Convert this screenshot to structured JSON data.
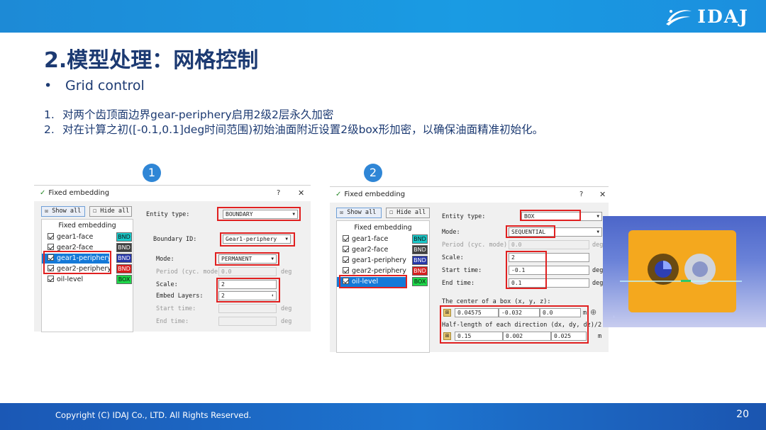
{
  "brand": {
    "logo_text": "IDAJ"
  },
  "slide": {
    "title": "2.模型处理：网格控制",
    "bullet": "Grid control",
    "items": [
      {
        "num": "1.",
        "text": "对两个齿顶面边界gear-periphery启用2级2层永久加密"
      },
      {
        "num": "2.",
        "text": "对在计算之初([-0.1,0.1]deg时间范围)初始油面附近设置2级box形加密，以确保油面精准初始化。"
      }
    ],
    "marker1": "1",
    "marker2": "2"
  },
  "dialog1": {
    "title": "Fixed embedding",
    "help": "?",
    "close": "✕",
    "show_all": "Show all",
    "hide_all": "Hide all",
    "tree_header": "Fixed embedding",
    "items": [
      {
        "label": "gear1-face",
        "tag": "BND",
        "tag_color": "#19c8c8"
      },
      {
        "label": "gear2-face",
        "tag": "BND",
        "tag_color": "#404040"
      },
      {
        "label": "gear1-periphery",
        "tag": "BND",
        "tag_color": "#2535a8"
      },
      {
        "label": "gear2-periphery",
        "tag": "BND",
        "tag_color": "#d81e1e"
      },
      {
        "label": "oil-level",
        "tag": "BOX",
        "tag_color": "#1ed84a"
      }
    ],
    "entity_type_label": "Entity type:",
    "entity_type_value": "BOUNDARY",
    "boundary_id_label": "Boundary ID:",
    "boundary_id_value": "Gear1-periphery",
    "mode_label": "Mode:",
    "mode_value": "PERMANENT",
    "period_label": "Period (cyc. mode):",
    "period_value": "0.0",
    "period_unit": "deg",
    "scale_label": "Scale:",
    "scale_value": "2",
    "embed_layers_label": "Embed Layers:",
    "embed_layers_value": "2",
    "start_time_label": "Start time:",
    "start_time_unit": "deg",
    "end_time_label": "End time:",
    "end_time_unit": "deg"
  },
  "dialog2": {
    "title": "Fixed embedding",
    "help": "?",
    "close": "✕",
    "show_all": "Show all",
    "hide_all": "Hide all",
    "tree_header": "Fixed embedding",
    "items": [
      {
        "label": "gear1-face",
        "tag": "BND",
        "tag_color": "#19c8c8"
      },
      {
        "label": "gear2-face",
        "tag": "BND",
        "tag_color": "#404040"
      },
      {
        "label": "gear1-periphery",
        "tag": "BND",
        "tag_color": "#2535a8"
      },
      {
        "label": "gear2-periphery",
        "tag": "BND",
        "tag_color": "#d81e1e"
      },
      {
        "label": "oil-level",
        "tag": "BOX",
        "tag_color": "#1ed84a"
      }
    ],
    "entity_type_label": "Entity type:",
    "entity_type_value": "BOX",
    "mode_label": "Mode:",
    "mode_value": "SEQUENTIAL",
    "period_label": "Period (cyc. mode):",
    "period_value": "0.0",
    "period_unit": "deg",
    "scale_label": "Scale:",
    "scale_value": "2",
    "start_time_label": "Start time:",
    "start_time_value": "-0.1",
    "start_time_unit": "deg",
    "end_time_label": "End time:",
    "end_time_value": "0.1",
    "end_time_unit": "deg",
    "center_label": "The center of a box (x, y, z):",
    "center_x": "0.04575",
    "center_y": "-0.032",
    "center_z": "0.0",
    "center_unit": "m",
    "half_label": "Half-length of each direction (dx, dy, dz)/2:",
    "half_x": "0.15",
    "half_y": "0.002",
    "half_z": "0.025",
    "half_unit": "m"
  },
  "footer": {
    "copyright": "Copyright (C)  IDAJ Co., LTD. All Rights Reserved.",
    "page": "20"
  },
  "colors": {
    "title": "#1c3a72",
    "topbar": "#1a9be3",
    "footer": "#1d74cf",
    "highlight": "#e02020",
    "gear_body": "#f4a81e"
  }
}
